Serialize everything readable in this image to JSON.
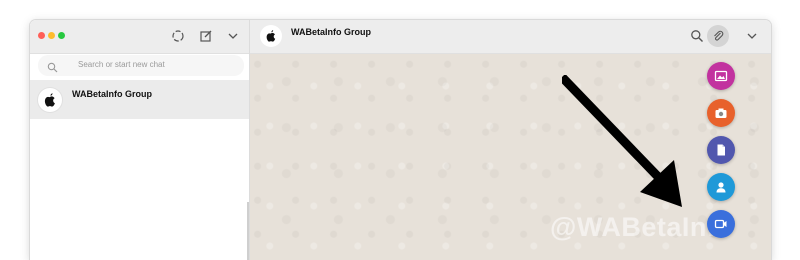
{
  "sidebar": {
    "search": {
      "placeholder": "Search or start new chat"
    },
    "chats": [
      {
        "name": "WABetaInfo Group"
      }
    ]
  },
  "conversation": {
    "title": "WABetaInfo Group"
  },
  "attach_menu": {
    "items": [
      {
        "icon": "photo-icon",
        "color": "#c2329f"
      },
      {
        "icon": "camera-icon",
        "color": "#e8612c"
      },
      {
        "icon": "document-icon",
        "color": "#5157ae"
      },
      {
        "icon": "contact-icon",
        "color": "#1f99d8"
      },
      {
        "icon": "video-camera-icon",
        "color": "#3a6fdc"
      }
    ]
  },
  "watermark": "@WABetaInfo"
}
